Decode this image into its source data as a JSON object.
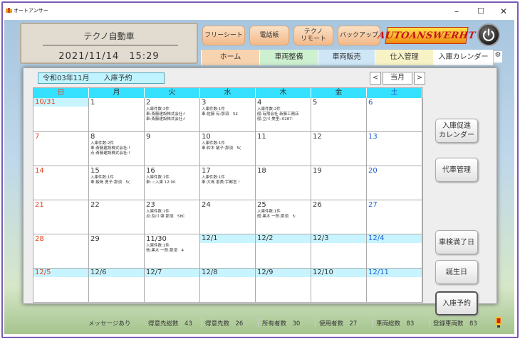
{
  "window": {
    "title": "オートアンサー",
    "minimize": "–",
    "maximize": "☐",
    "close": "✕"
  },
  "header": {
    "company": "テクノ自動車",
    "datetime": "2021/11/14　15:29"
  },
  "top_buttons": [
    "フリーシート",
    "電話帳",
    "テクノ\nリモート",
    "バックアップ"
  ],
  "logo_text": "AUTOANSWERHT",
  "tabs": [
    {
      "label": "ホーム",
      "color": "#f7d3af"
    },
    {
      "label": "車両整備",
      "color": "#cdf0cf"
    },
    {
      "label": "車両販売",
      "color": "#cfe6f7"
    },
    {
      "label": "仕入管理",
      "color": "#f8f3c6"
    },
    {
      "label": "入庫カレンダー",
      "color": "#ffffff"
    }
  ],
  "calendar": {
    "month_label": "令和03年11月　　入庫予約",
    "nav": {
      "prev": "<",
      "current": "当月",
      "next": ">"
    },
    "weekdays": [
      "日",
      "月",
      "火",
      "水",
      "木",
      "金",
      "土"
    ],
    "weekday_colors": [
      "#e8401c",
      "#333333",
      "#333333",
      "#333333",
      "#333333",
      "#333333",
      "#1d5fd0"
    ],
    "weeks": [
      [
        {
          "day": "10/31",
          "lines": [],
          "tinted": true
        },
        {
          "day": "1",
          "lines": []
        },
        {
          "day": "2",
          "lines": [
            "入庫件数:2件",
            "車:斎藤建設株式会社:!",
            "車:斎藤建設株式会社:!"
          ]
        },
        {
          "day": "3",
          "lines": [
            "入庫件数:1件",
            "車:佐藤 有:那須　5£"
          ]
        },
        {
          "day": "4",
          "lines": [
            "入庫件数:2件",
            "般:有限会社 新藤工務店",
            "般:立川 美里::0287-"
          ]
        },
        {
          "day": "5",
          "lines": []
        },
        {
          "day": "6",
          "lines": []
        }
      ],
      [
        {
          "day": "7",
          "lines": []
        },
        {
          "day": "8",
          "lines": [
            "入庫件数:2件",
            "車:斎藤建設株式会社:!",
            "点:斎藤建設株式会社:!"
          ]
        },
        {
          "day": "9",
          "lines": []
        },
        {
          "day": "10",
          "lines": [
            "入庫件数:1件",
            "車:鈴木 敏子:那須　5("
          ]
        },
        {
          "day": "11",
          "lines": []
        },
        {
          "day": "12",
          "lines": []
        },
        {
          "day": "13",
          "lines": []
        }
      ],
      [
        {
          "day": "14",
          "lines": []
        },
        {
          "day": "15",
          "lines": [
            "入庫件数:1件",
            "車:飯島 勇子:那須　5("
          ]
        },
        {
          "day": "16",
          "lines": [
            "入庫件数:1件",
            "車::::入庫 12:00"
          ]
        },
        {
          "day": "17",
          "lines": [
            "入庫件数:1件",
            "車:大島 恵美:宇都宮 !"
          ]
        },
        {
          "day": "18",
          "lines": []
        },
        {
          "day": "19",
          "lines": []
        },
        {
          "day": "20",
          "lines": []
        }
      ],
      [
        {
          "day": "21",
          "lines": []
        },
        {
          "day": "22",
          "lines": []
        },
        {
          "day": "23",
          "lines": [
            "入庫件数:1件",
            "点:及川 肇:那須　58C"
          ]
        },
        {
          "day": "24",
          "lines": []
        },
        {
          "day": "25",
          "lines": [
            "入庫件数:1件",
            "般:黒木 一郎:那須　5:"
          ]
        },
        {
          "day": "26",
          "lines": []
        },
        {
          "day": "27",
          "lines": []
        }
      ],
      [
        {
          "day": "28",
          "lines": []
        },
        {
          "day": "29",
          "lines": []
        },
        {
          "day": "11/30",
          "lines": [
            "入庫件数:1件",
            "他:黒木 一郎:那須　4"
          ]
        },
        {
          "day": "12/1",
          "lines": [],
          "tinted": true
        },
        {
          "day": "12/2",
          "lines": [],
          "tinted": true
        },
        {
          "day": "12/3",
          "lines": [],
          "tinted": true
        },
        {
          "day": "12/4",
          "lines": [],
          "tinted": true
        }
      ],
      [
        {
          "day": "12/5",
          "lines": [],
          "tinted": true
        },
        {
          "day": "12/6",
          "lines": [],
          "tinted": true
        },
        {
          "day": "12/7",
          "lines": [],
          "tinted": true
        },
        {
          "day": "12/8",
          "lines": [],
          "tinted": true
        },
        {
          "day": "12/9",
          "lines": [],
          "tinted": true
        },
        {
          "day": "12/10",
          "lines": [],
          "tinted": true
        },
        {
          "day": "12/11",
          "lines": [],
          "tinted": true
        }
      ]
    ]
  },
  "side_buttons": [
    {
      "label": "入庫促進\nカレンダー"
    },
    {
      "label": "代車管理"
    },
    {
      "label": "車検満了日"
    },
    {
      "label": "誕生日"
    },
    {
      "label": "入庫予約",
      "active": true
    }
  ],
  "status": {
    "message": "メッセージあり",
    "items": [
      "得意先総数　43",
      "得意先数　26",
      "所有者数　30",
      "使用者数　27",
      "車両総数　83",
      "登録車両数　83"
    ]
  }
}
